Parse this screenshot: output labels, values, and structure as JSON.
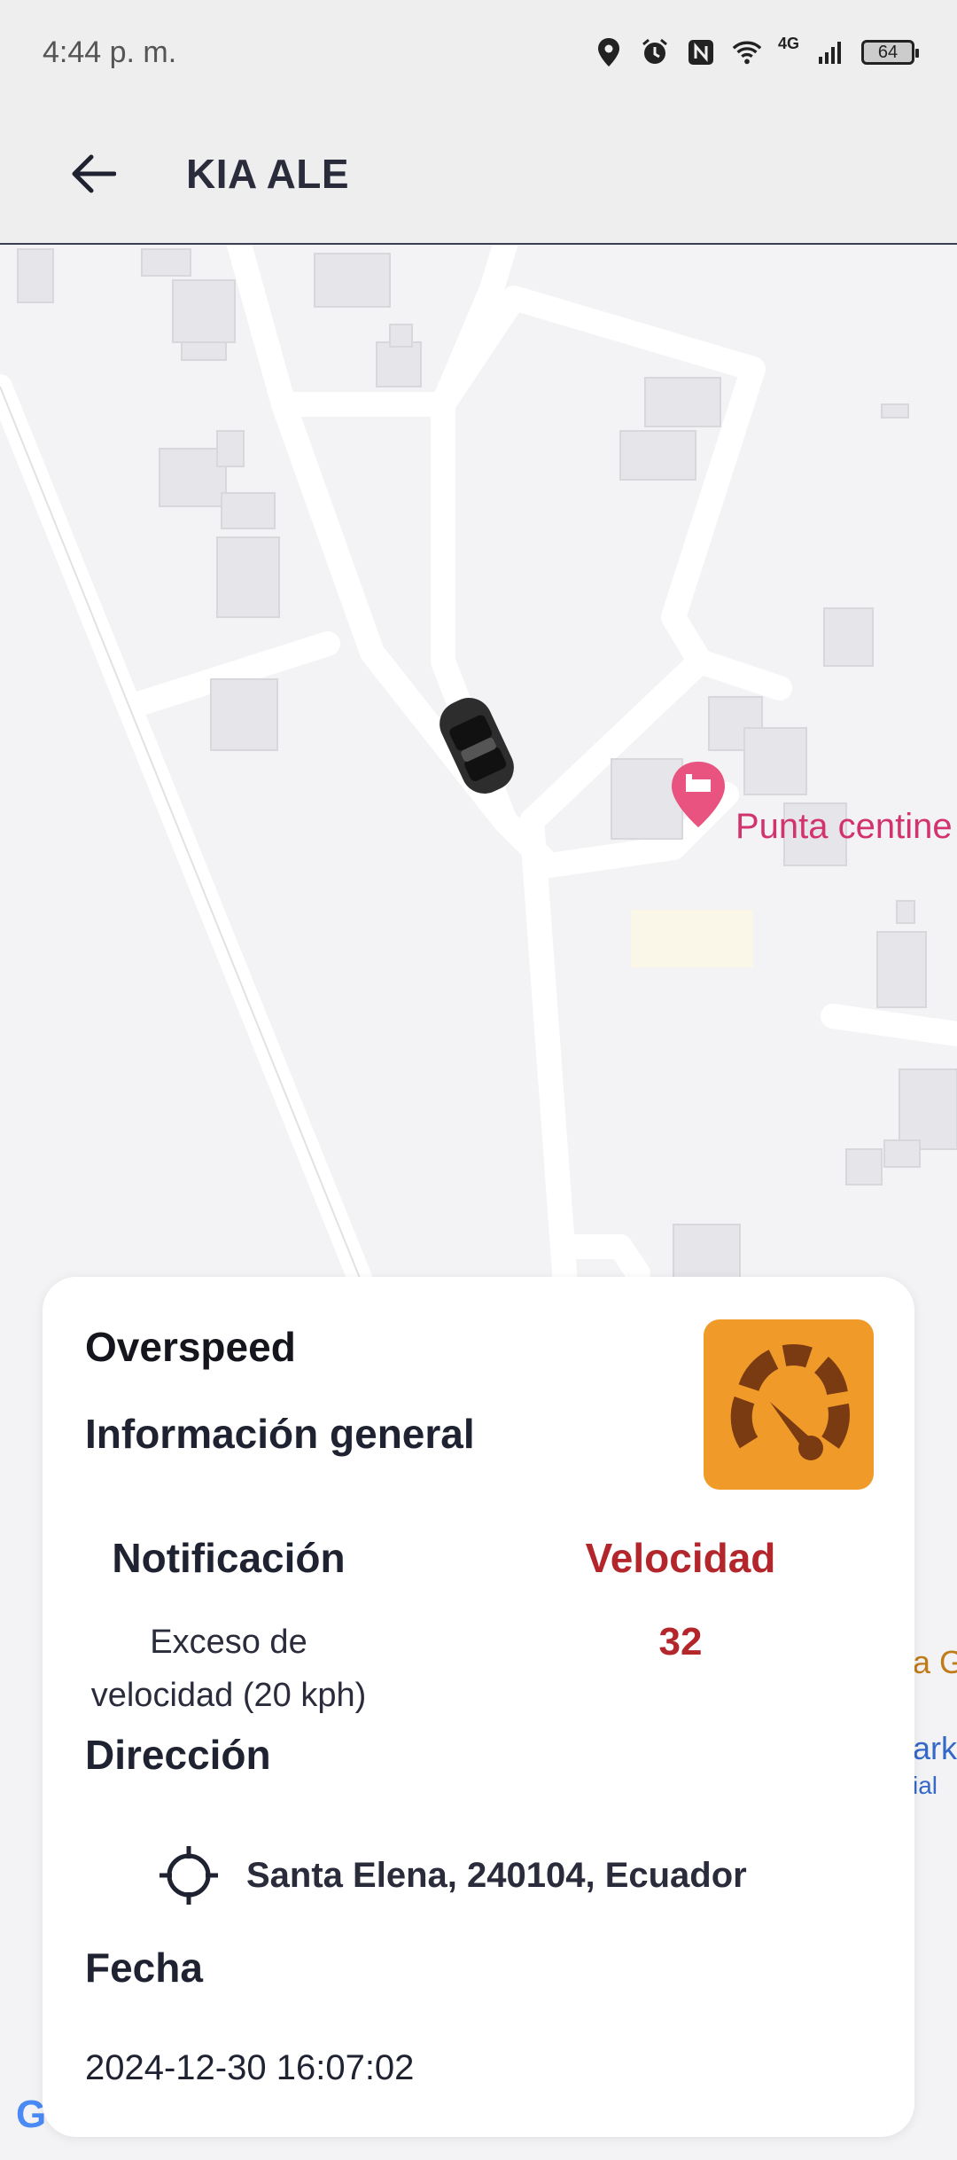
{
  "status_bar": {
    "time": "4:44 p. m.",
    "network": "4G",
    "battery": "64",
    "icons": [
      "location-icon",
      "alarm-icon",
      "nfc-icon",
      "wifi-icon",
      "signal-icon",
      "battery-icon"
    ]
  },
  "app_bar": {
    "title": "KIA ALE",
    "back_icon": "arrow-left-icon"
  },
  "map": {
    "poi_label": "Punta centine",
    "poi_icon": "hotel-pin-icon",
    "vehicle_icon": "car-icon",
    "side_fragment_1": "a G",
    "side_fragment_2": "ark",
    "side_fragment_3": "ial",
    "attribution": "G"
  },
  "event": {
    "type": "Overspeed",
    "icon": "speedometer-icon",
    "icon_color": "#f09a2a",
    "general_title": "Información general",
    "notification_header": "Notificación",
    "notification_value": "Exceso de velocidad (20 kph)",
    "speed_header": "Velocidad",
    "speed_value": "32",
    "speed_color": "#b3262b",
    "address_title": "Dirección",
    "address_icon": "crosshair-icon",
    "address": "Santa Elena, 240104, Ecuador",
    "date_title": "Fecha",
    "date": "2024-12-30 16:07:02"
  }
}
